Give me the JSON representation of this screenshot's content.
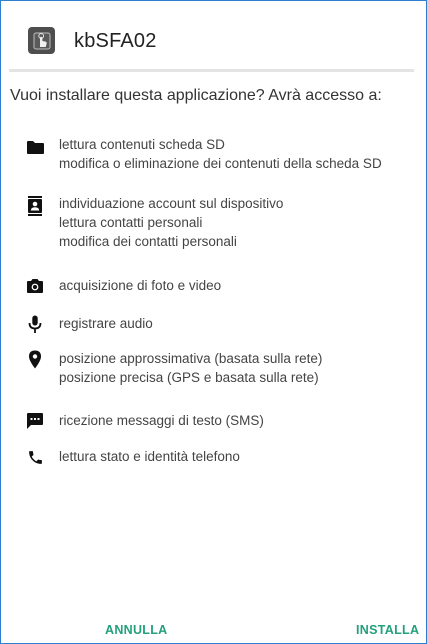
{
  "dialog": {
    "app_name": "kbSFA02",
    "app_icon": "touch-hand-icon",
    "question": "Vuoi installare questa applicazione? Avrà accesso a:",
    "accent_color": "#23a07c"
  },
  "permissions": [
    {
      "icon": "folder-icon",
      "lines": [
        "lettura contenuti scheda SD",
        "modifica o eliminazione dei contenuti della scheda SD"
      ]
    },
    {
      "icon": "contacts-icon",
      "lines": [
        "individuazione account sul dispositivo",
        "lettura contatti personali",
        "modifica dei contatti personali"
      ]
    },
    {
      "icon": "camera-icon",
      "lines": [
        "acquisizione di foto e video"
      ]
    },
    {
      "icon": "microphone-icon",
      "lines": [
        "registrare audio"
      ]
    },
    {
      "icon": "location-pin-icon",
      "lines": [
        "posizione approssimativa (basata sulla rete)",
        "posizione precisa (GPS e basata sulla rete)"
      ]
    },
    {
      "icon": "message-icon",
      "lines": [
        "ricezione messaggi di testo (SMS)"
      ]
    },
    {
      "icon": "phone-icon",
      "lines": [
        "lettura stato e identità telefono"
      ]
    }
  ],
  "buttons": {
    "cancel": "ANNULLA",
    "install": "INSTALLA"
  }
}
